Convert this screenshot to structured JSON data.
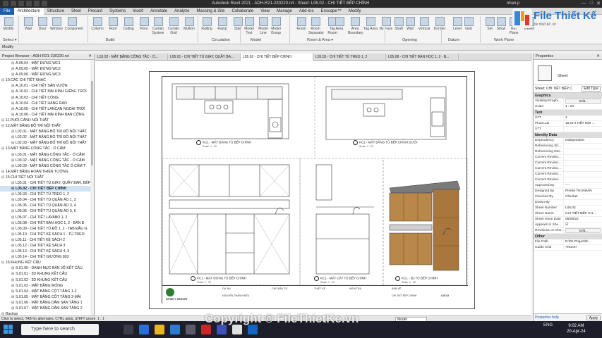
{
  "app": {
    "title": "Autodesk Revit 2021 - ADH-R21-230220.rvt - Sheet: L05.02 - CHI TIẾT BẾP CHÍNH",
    "user": "nhan.p",
    "window_controls": [
      "—",
      "□",
      "✕"
    ]
  },
  "menu": {
    "items": [
      "File",
      "Architecture",
      "Structure",
      "Steel",
      "Precast",
      "Systems",
      "Insert",
      "Annotate",
      "Analyze",
      "Massing & Site",
      "Collaborate",
      "View",
      "Manage",
      "Add-Ins",
      "Enscape™",
      "Modify"
    ]
  },
  "ribbon": {
    "tools": [
      "Modify",
      "Wall",
      "Door",
      "Window",
      "Component",
      "Column",
      "Roof",
      "Ceiling",
      "Floor",
      "Curtain System",
      "Curtain Grid",
      "Mullion",
      "Railing",
      "Ramp",
      "Stair",
      "Model Text",
      "Model Line",
      "Model Group",
      "Room",
      "Room Separator",
      "Tag Room",
      "Area",
      "Area Boundary",
      "Tag Area",
      "By Face",
      "Shaft",
      "Wall",
      "Vertical",
      "Dormer",
      "Level",
      "Grid",
      "Set",
      "Show",
      "Ref Plane",
      "Viewer"
    ],
    "panels": [
      "Select ▾",
      "Build",
      "Circulation",
      "Model",
      "Room & Area ▾",
      "Opening",
      "Datum",
      "Work Plane"
    ]
  },
  "options_bar": "Modify",
  "project_browser": {
    "title": "Project Browser - ADH-R21-230220.rvt",
    "close": "✕",
    "rows": [
      {
        "level": 2,
        "label": "A.09.04 - MẶT ĐỨNG WC1",
        "bold": false
      },
      {
        "level": 2,
        "label": "A.09.05 - MẶT ĐỨNG WC2",
        "bold": false
      },
      {
        "level": 2,
        "label": "A.09.06 - MẶT ĐỨNG WC3",
        "bold": false
      },
      {
        "level": 1,
        "label": "10.CÁC CHI TIẾT KHÁC",
        "bold": false
      },
      {
        "level": 2,
        "label": "A.10.01 - CHI TIẾT SÂN VƯỜN",
        "bold": false
      },
      {
        "level": 2,
        "label": "A.10.02 - CHI TIẾT MÁI KÍNH GIẾNG TRỜI",
        "bold": false
      },
      {
        "level": 2,
        "label": "A.10.03 - CHI TIẾT CỔNG",
        "bold": false
      },
      {
        "level": 2,
        "label": "A.10.04 - CHI TIẾT HÀNG RÀO",
        "bold": false
      },
      {
        "level": 2,
        "label": "A.10.05 - CHI TIẾT LANCAN NGOÀI TRỜI",
        "bold": false
      },
      {
        "level": 2,
        "label": "A.10.06 - CHI TIẾT MÁI KÍNH BAN CÔNG",
        "bold": false
      },
      {
        "level": 1,
        "label": "11.PHỐI CẢNH NỘI THẤT",
        "bold": false
      },
      {
        "level": 1,
        "label": "12.MẶT BẰNG BỐ TRÍ NỘI THẤT",
        "bold": false
      },
      {
        "level": 2,
        "label": "L02.01 - MẶT BẰNG BỐ TRÍ ĐỒ NỘI THẤT",
        "bold": false
      },
      {
        "level": 2,
        "label": "L02.02 - MẶT BẰNG BỐ TRÍ ĐỒ NỘI THẤT",
        "bold": false
      },
      {
        "level": 2,
        "label": "L02.03 - MẶT BẰNG BỐ TRÍ ĐỒ NỘI THẤT",
        "bold": false
      },
      {
        "level": 1,
        "label": "13.MẶT BẰNG CÔNG TẮC - Ổ CẮM",
        "bold": false
      },
      {
        "level": 2,
        "label": "L03.01 - MẶT BẰNG CÔNG TẮC - Ổ CẮM",
        "bold": false
      },
      {
        "level": 2,
        "label": "L03.02 - MẶT BẰNG CÔNG TẮC - Ổ CẮM",
        "bold": false
      },
      {
        "level": 2,
        "label": "L03.03 - MẶT BẰNG CÔNG TẮC Ổ CẮM T",
        "bold": false
      },
      {
        "level": 1,
        "label": "14.MẶT BẰNG HOÀN THIỆN TƯỜNG",
        "bold": false
      },
      {
        "level": 1,
        "label": "15.CHI TIẾT NỘI THẤT",
        "bold": false
      },
      {
        "level": 2,
        "label": "L05.01 - CHI TIẾT TỦ GIÀY, QUẦY BAR, BẾP",
        "bold": false
      },
      {
        "level": 2,
        "label": "L05.02 - CHI TIẾT BẾP CHÍNH",
        "bold": true
      },
      {
        "level": 2,
        "label": "L05.03 - CHI TIẾT TỦ TREO 1, 2",
        "bold": false
      },
      {
        "level": 2,
        "label": "L05.04 - CHI TIẾT TỦ QUẦN ÁO 1, 2",
        "bold": false
      },
      {
        "level": 2,
        "label": "L05.05 - CHI TIẾT TỦ QUẦN ÁO 3, 4",
        "bold": false
      },
      {
        "level": 2,
        "label": "L05.06 - CHI TIẾT TỦ QUẦN ÁO 5, 6",
        "bold": false
      },
      {
        "level": 2,
        "label": "L05.07 - CHI TIẾT LAVABO 1, 2",
        "bold": false
      },
      {
        "level": 2,
        "label": "L05.08 - CHI TIẾT BÀN HỌC 1, 2 - BÀN Đ",
        "bold": false
      },
      {
        "level": 2,
        "label": "L05.09 - CHI TIẾT TỦ ĐỒ 1, 2 - TAB ĐẦU G",
        "bold": false
      },
      {
        "level": 2,
        "label": "L05.10 - CHI TIẾT KỆ SÁCH 1 - TỦ TREO",
        "bold": false
      },
      {
        "level": 2,
        "label": "L05.11 - CHI TIẾT KỆ SÁCH 2",
        "bold": false
      },
      {
        "level": 2,
        "label": "L05.12 - CHI TIẾT KỆ SÁCH 3",
        "bold": false
      },
      {
        "level": 2,
        "label": "L05.13 - CHI TIẾT KỆ SÁCH 4, 5",
        "bold": false
      },
      {
        "level": 2,
        "label": "L05.14 - CHI TIẾT GIƯỜNG 803",
        "bold": false
      },
      {
        "level": 1,
        "label": "16.KHUNG KẾT CẤU",
        "bold": false
      },
      {
        "level": 2,
        "label": "S.01.00 - DANH MỤC BẢN VẼ KẾT CẤU",
        "bold": false
      },
      {
        "level": 2,
        "label": "S.01.01 - 3D KHUNG KẾT CẤU",
        "bold": false
      },
      {
        "level": 2,
        "label": "S.01.02 - 3D KHUNG KẾT CẤU",
        "bold": false
      },
      {
        "level": 2,
        "label": "S.01.03 - MẶT BẰNG MÓNG",
        "bold": false
      },
      {
        "level": 2,
        "label": "S.01.04 - MẶT BẰNG CỘT TẦNG 1-2",
        "bold": false
      },
      {
        "level": 2,
        "label": "S.01.05 - MẶT BẰNG CỘT TẦNG 3-MÁI",
        "bold": false
      },
      {
        "level": 2,
        "label": "S.01.06 - MẶT BẰNG DẦM SÀN TẦNG 1",
        "bold": false
      },
      {
        "level": 2,
        "label": "S.01.07 - MẶT BẰNG DẦM SÀN TẦNG 2",
        "bold": false
      },
      {
        "level": 1,
        "label": "Backup",
        "bold": false
      }
    ]
  },
  "tabs": [
    {
      "label": "L03.02 - MẶT BẰNG CÔNG TẮC - Ổ...",
      "active": false
    },
    {
      "label": "L05.01 - CHI TIẾT TỦ GIÀY, QUẦY BA...",
      "active": false
    },
    {
      "label": "L05.02 - CHI TIẾT BẾP CHÍNH",
      "active": true
    },
    {
      "label": "L05.03 - CHI TIẾT TỦ TREO 1, 2",
      "active": false
    },
    {
      "label": "L05.08 - CHI TIẾT BÀN HỌC 1, 2 - B...",
      "active": false
    },
    {
      "label": "",
      "active": false
    }
  ],
  "sheet": {
    "views": {
      "plan_top": {
        "title": "KC1 - MẶT BẰNG TỦ BẾP CHÍNH",
        "scale": "Scale: 1 : 20"
      },
      "plan_lower": {
        "title": "KC1 - MẶT BẰNG TỦ BẾP CHÍNH DƯỚI",
        "scale": "Scale: 1 : 20"
      },
      "elev": {
        "title": "KC1 - MẶT ĐỨNG TỦ BẾP CHÍNH",
        "scale": "Scale: 1 : 20"
      },
      "section": {
        "title": "KC1 - MẶT CẮT TỦ BẾP CHÍNH",
        "scale": "Scale: 1 : 20"
      },
      "view3d": {
        "title": "KC1 - 3D TỦ BẾP CHÍNH",
        "scale": "Scale: 1 : 20"
      }
    },
    "titleblock": {
      "company": "INFINITY RESORT",
      "cells": [
        "DỰ ÁN",
        "NGUYỄN THANH HIẾU",
        "CHỦ ĐẦU TƯ",
        "THIẾT KẾ",
        "KIỂM TRA",
        "BẢN VẼ",
        "CHI TIẾT BẾP CHÍNH",
        "L05.02"
      ]
    }
  },
  "canvas_status": "1 : 1",
  "properties": {
    "title": "Properties",
    "close": "✕",
    "type_name": "Sheet",
    "filter": "Sheet: CHI TIẾT BẾP C",
    "edit_type": "Edit Type",
    "groups": [
      {
        "name": "Graphics",
        "rows": [
          {
            "k": "Visibility/Graphi...",
            "v": "Edit...",
            "btn": true
          },
          {
            "k": "Scale",
            "v": "1 : 20",
            "btn": false
          }
        ]
      },
      {
        "name": "Text",
        "rows": [
          {
            "k": "STT",
            "v": "2",
            "btn": false
          },
          {
            "k": "PhanLoai",
            "v": "15.CHI TIẾT NỘI ...",
            "btn": false
          },
          {
            "k": "STT",
            "v": "",
            "btn": false
          }
        ]
      },
      {
        "name": "Identity Data",
        "rows": [
          {
            "k": "Dependency",
            "v": "Independent",
            "btn": false
          },
          {
            "k": "Referencing Sh...",
            "v": "",
            "btn": false
          },
          {
            "k": "Referencing Det...",
            "v": "",
            "btn": false
          },
          {
            "k": "Current Revisio...",
            "v": "",
            "btn": false
          },
          {
            "k": "Current Revisio...",
            "v": "",
            "btn": false
          },
          {
            "k": "Current Revisio...",
            "v": "",
            "btn": false
          },
          {
            "k": "Current Revisio...",
            "v": "",
            "btn": false
          },
          {
            "k": "Current Revisio...",
            "v": "",
            "btn": false
          },
          {
            "k": "Approved By",
            "v": "----",
            "btn": false
          },
          {
            "k": "Designed By",
            "v": "PHẠM THỊ NHÀN",
            "btn": false
          },
          {
            "k": "Checked By",
            "v": "Checker",
            "btn": false
          },
          {
            "k": "Drawn By",
            "v": "",
            "btn": false
          },
          {
            "k": "Sheet Number",
            "v": "L05.02",
            "btn": false
          },
          {
            "k": "Sheet Name",
            "v": "CHI TIẾT BẾP CH...",
            "btn": false
          },
          {
            "k": "Sheet Issue Date",
            "v": "05/08/22",
            "btn": false
          },
          {
            "k": "Appears In She...",
            "v": "☑",
            "btn": false
          },
          {
            "k": "Revisions on She...",
            "v": "Edit...",
            "btn": true
          }
        ]
      },
      {
        "name": "Other",
        "rows": [
          {
            "k": "File Path",
            "v": "D:\\01.Project\\0...",
            "btn": false
          },
          {
            "k": "Guide Grid",
            "v": "<None>",
            "btn": false
          }
        ]
      }
    ],
    "help": "Properties help",
    "apply": "Apply"
  },
  "logo": {
    "text": "File Thiết Kế",
    "sub": "file thiết kế .vn"
  },
  "status": {
    "left": "Click to select, TAB for alternates, CTRL adds, SHIFT unselects.",
    "model": "Model"
  },
  "taskbar": {
    "search": "Type here to search",
    "tray": "ENG",
    "time": "9:02 AM",
    "date": "20-Apr-24"
  },
  "watermark": "Copyright © FileThietKe.vn"
}
